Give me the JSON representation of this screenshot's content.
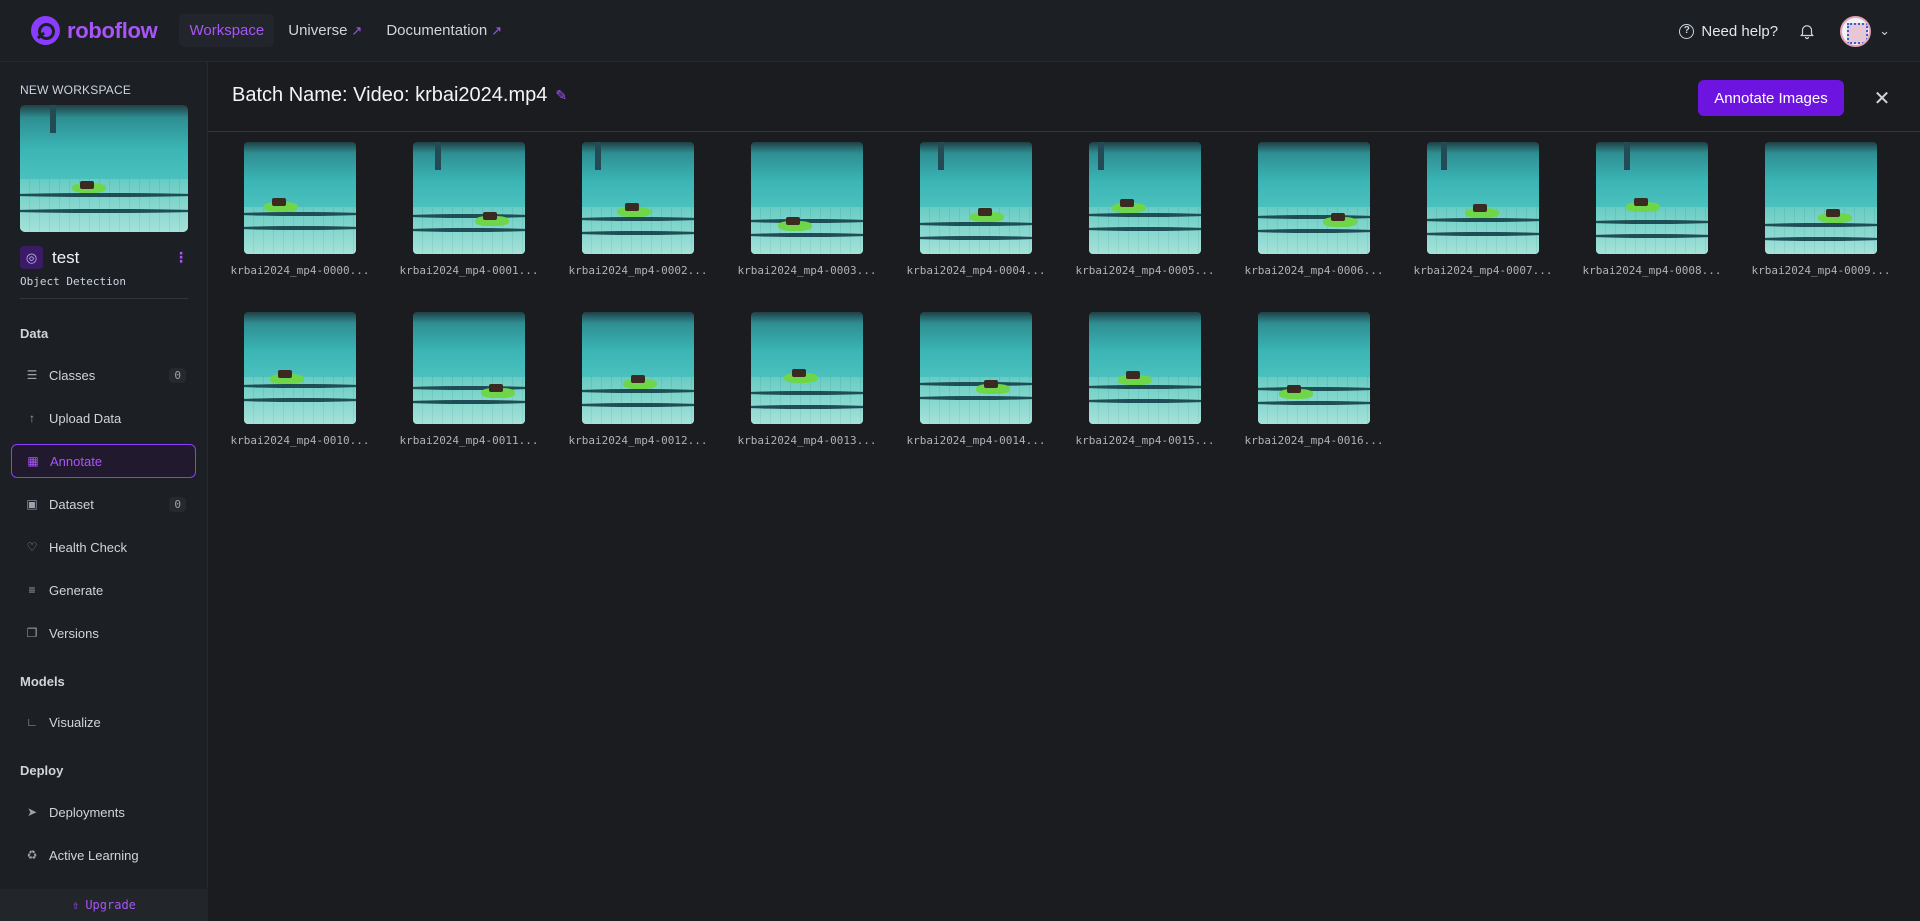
{
  "header": {
    "logo_text": "roboflow",
    "nav": [
      {
        "label": "Workspace",
        "external": false
      },
      {
        "label": "Universe",
        "external": true
      },
      {
        "label": "Documentation",
        "external": true
      }
    ],
    "help_label": "Need help?",
    "external_glyph": "↗"
  },
  "sidebar": {
    "workspace_title": "NEW WORKSPACE",
    "project_name": "test",
    "project_type": "Object Detection",
    "sections": {
      "data": "Data",
      "models": "Models",
      "deploy": "Deploy"
    },
    "items": [
      {
        "label": "Classes",
        "icon": "list-icon",
        "count": "0"
      },
      {
        "label": "Upload Data",
        "icon": "upload-icon"
      },
      {
        "label": "Annotate",
        "icon": "annotate-icon",
        "active": true
      },
      {
        "label": "Dataset",
        "icon": "images-icon",
        "count": "0"
      },
      {
        "label": "Health Check",
        "icon": "heart-pulse-icon"
      },
      {
        "label": "Generate",
        "icon": "stack-icon"
      },
      {
        "label": "Versions",
        "icon": "versions-icon"
      },
      {
        "label": "Visualize",
        "icon": "chart-icon"
      },
      {
        "label": "Deployments",
        "icon": "rocket-icon"
      },
      {
        "label": "Active Learning",
        "icon": "recycle-icon"
      }
    ],
    "upgrade_label": "Upgrade"
  },
  "main": {
    "batch_title": "Batch Name: Video: krbai2024.mp4",
    "annotate_button": "Annotate Images",
    "images": [
      "krbai2024_mp4-0000...",
      "krbai2024_mp4-0001...",
      "krbai2024_mp4-0002...",
      "krbai2024_mp4-0003...",
      "krbai2024_mp4-0004...",
      "krbai2024_mp4-0005...",
      "krbai2024_mp4-0006...",
      "krbai2024_mp4-0007...",
      "krbai2024_mp4-0008...",
      "krbai2024_mp4-0009...",
      "krbai2024_mp4-0010...",
      "krbai2024_mp4-0011...",
      "krbai2024_mp4-0012...",
      "krbai2024_mp4-0013...",
      "krbai2024_mp4-0014...",
      "krbai2024_mp4-0015...",
      "krbai2024_mp4-0016..."
    ]
  },
  "colors": {
    "accent": "#8b3dff",
    "primary_button": "#6d14e0",
    "background": "#1a1c1f"
  }
}
